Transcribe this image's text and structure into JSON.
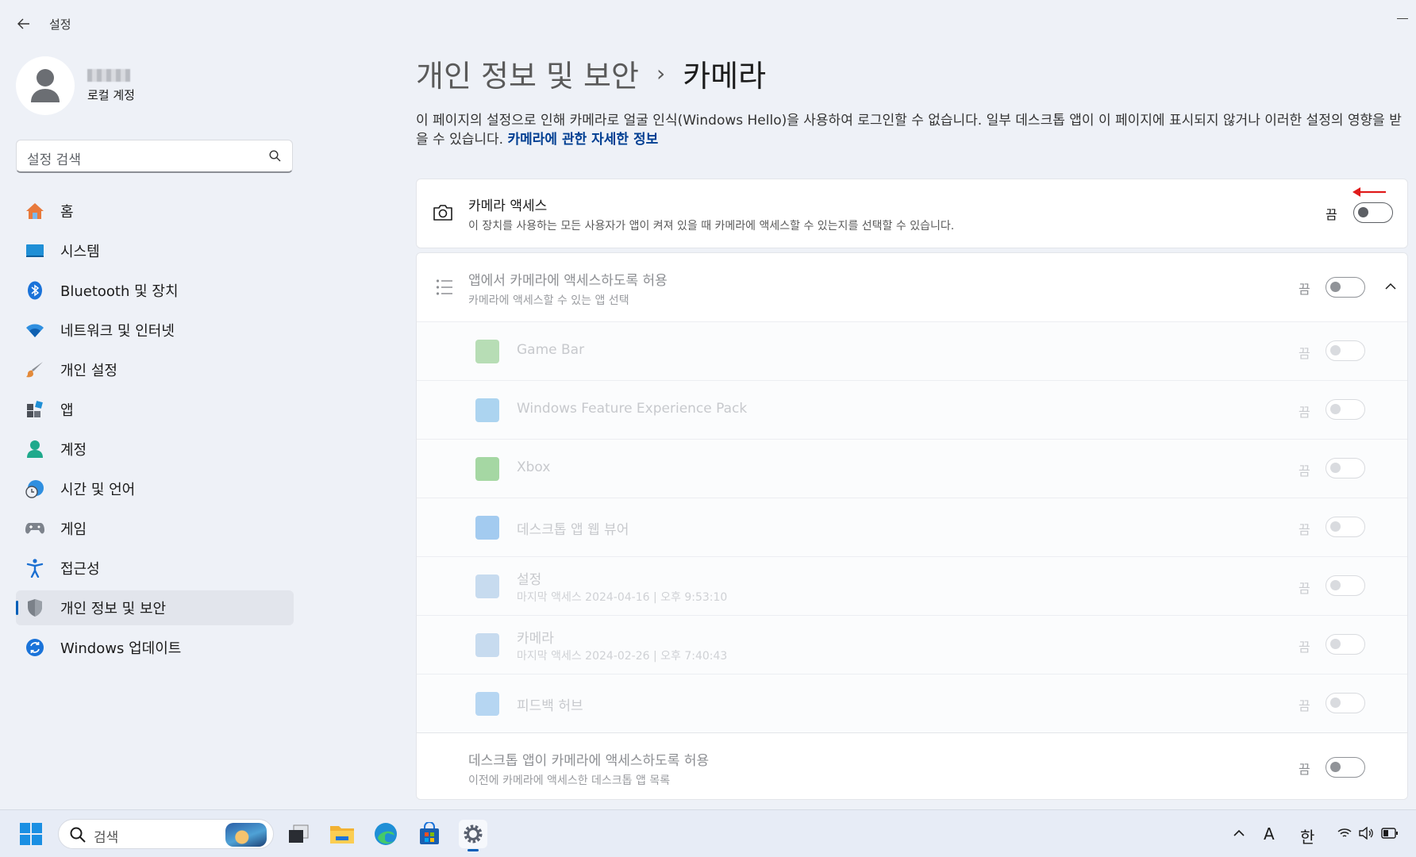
{
  "window": {
    "title": "설정"
  },
  "profile": {
    "account_type": "로컬 계정"
  },
  "search": {
    "placeholder": "설정 검색"
  },
  "sidebar": {
    "items": [
      {
        "label": "홈",
        "icon": "home-icon"
      },
      {
        "label": "시스템",
        "icon": "system-icon"
      },
      {
        "label": "Bluetooth 및 장치",
        "icon": "bluetooth-icon"
      },
      {
        "label": "네트워크 및 인터넷",
        "icon": "wifi-icon"
      },
      {
        "label": "개인 설정",
        "icon": "brush-icon"
      },
      {
        "label": "앱",
        "icon": "apps-icon"
      },
      {
        "label": "계정",
        "icon": "account-icon"
      },
      {
        "label": "시간 및 언어",
        "icon": "clock-globe-icon"
      },
      {
        "label": "게임",
        "icon": "gamepad-icon"
      },
      {
        "label": "접근성",
        "icon": "accessibility-icon"
      },
      {
        "label": "개인 정보 및 보안",
        "icon": "shield-icon",
        "active": true
      },
      {
        "label": "Windows 업데이트",
        "icon": "update-icon"
      }
    ]
  },
  "header": {
    "parent": "개인 정보 및 보안",
    "separator": "›",
    "current": "카메라"
  },
  "description": {
    "text": "이 페이지의 설정으로 인해 카메라로 얼굴 인식(Windows Hello)을 사용하여 로그인할 수 없습니다. 일부 데스크톱 앱이 이 페이지에 표시되지 않거나 이러한 설정의 영향을 받을 수 있습니다.",
    "link": "카메라에 관한 자세한 정보"
  },
  "camera_access": {
    "title": "카메라 액세스",
    "subtitle": "이 장치를 사용하는 모든 사용자가 앱이 켜져 있을 때 카메라에 액세스할 수 있는지를 선택할 수 있습니다.",
    "state": "끔",
    "on": false
  },
  "app_access": {
    "title": "앱에서 카메라에 액세스하도록 허용",
    "subtitle": "카메라에 액세스할 수 있는 앱 선택",
    "state": "끔",
    "on": false
  },
  "apps": [
    {
      "name": "Game Bar",
      "meta": "",
      "state": "끔",
      "color": "#7fc27a"
    },
    {
      "name": "Windows Feature Experience Pack",
      "meta": "",
      "state": "끔",
      "color": "#6cb3e6"
    },
    {
      "name": "Xbox",
      "meta": "",
      "state": "끔",
      "color": "#5fb85a"
    },
    {
      "name": "데스크톱 앱 웹 뷰어",
      "meta": "",
      "state": "끔",
      "color": "#7db6ea"
    },
    {
      "name": "설정",
      "meta": "마지막 액세스 2024-04-16  |  오후 9:53:10",
      "state": "끔",
      "color": "#9cc0e4"
    },
    {
      "name": "카메라",
      "meta": "마지막 액세스 2024-02-26  |  오후 7:40:43",
      "state": "끔",
      "color": "#9cc0e4"
    },
    {
      "name": "피드백 허브",
      "meta": "",
      "state": "끔",
      "color": "#7db6ea"
    }
  ],
  "desktop_access": {
    "title": "데스크톱 앱이 카메라에 액세스하도록 허용",
    "subtitle": "이전에 카메라에 액세스한 데스크톱 앱 목록",
    "state": "끔",
    "on": false
  },
  "taskbar": {
    "search_placeholder": "검색",
    "ime_mode": "A",
    "ime_lang": "한"
  }
}
